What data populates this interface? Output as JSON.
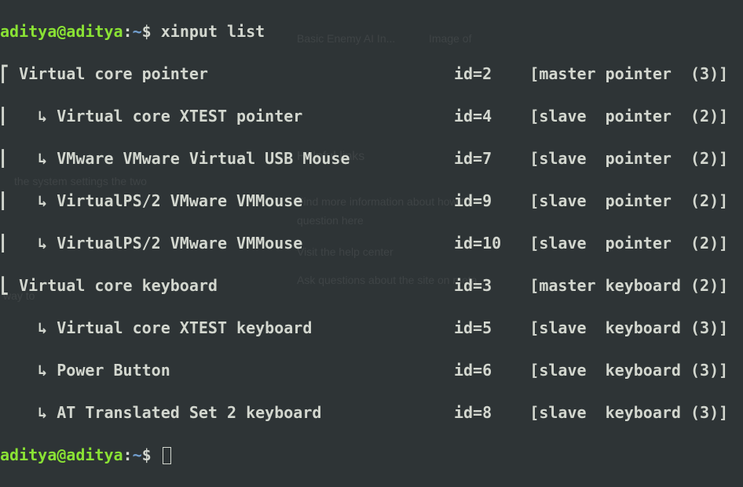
{
  "prompt1": {
    "user": "aditya@aditya",
    "colon": ":",
    "path": "~",
    "dollar": "$ ",
    "command": "xinput list"
  },
  "output": [
    "⎡ Virtual core pointer                          id=2    [master pointer  (3)]",
    "⎜   ↳ Virtual core XTEST pointer                id=4    [slave  pointer  (2)]",
    "⎜   ↳ VMware VMware Virtual USB Mouse           id=7    [slave  pointer  (2)]",
    "⎜   ↳ VirtualPS/2 VMware VMMouse                id=9    [slave  pointer  (2)]",
    "⎜   ↳ VirtualPS/2 VMware VMMouse                id=10   [slave  pointer  (2)]",
    "⎣ Virtual core keyboard                         id=3    [master keyboard (2)]",
    "    ↳ Virtual core XTEST keyboard               id=5    [slave  keyboard (3)]",
    "    ↳ Power Button                              id=6    [slave  keyboard (3)]",
    "    ↳ AT Translated Set 2 keyboard              id=8    [slave  keyboard (3)]"
  ],
  "prompt2": {
    "user": "aditya@aditya",
    "colon": ":",
    "path": "~",
    "dollar": "$ "
  },
  "ghosts": {
    "g1": "Basic Enemy AI In...",
    "g2": "Image of",
    "g3": "Helpful links",
    "g4": "Find more information about how to",
    "g5": "question here",
    "g6": "Visit the help center",
    "g7": "Ask questions about the site on meta",
    "g8": "the system settings the two",
    "g9": "way to"
  }
}
